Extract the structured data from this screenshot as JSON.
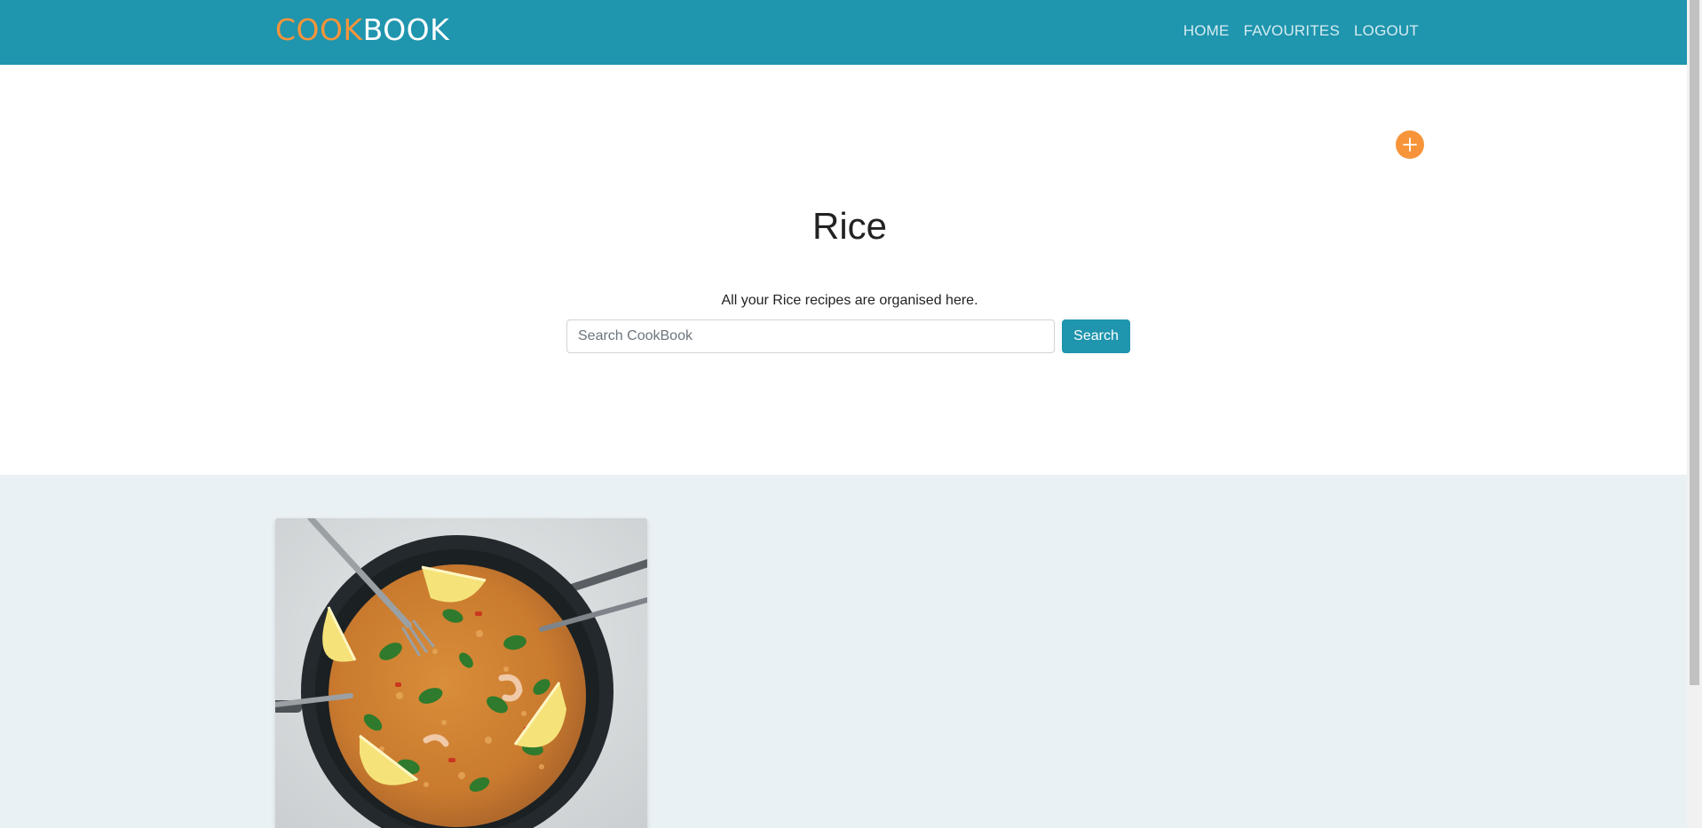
{
  "navbar": {
    "brand_part1": "COOK",
    "brand_part2": "BOOK",
    "links": [
      "HOME",
      "FAVOURITES",
      "LOGOUT"
    ]
  },
  "hero": {
    "add_icon": "plus-icon",
    "title": "Rice",
    "subtitle": "All your Rice recipes are organised here."
  },
  "search": {
    "placeholder": "Search CookBook",
    "value": "",
    "button_label": "Search"
  },
  "colors": {
    "primary": "#1f95ae",
    "accent": "#f7943a",
    "content_bg": "#eaf1f4"
  },
  "recipes": [
    {
      "image": "paella-dish-photo"
    }
  ]
}
